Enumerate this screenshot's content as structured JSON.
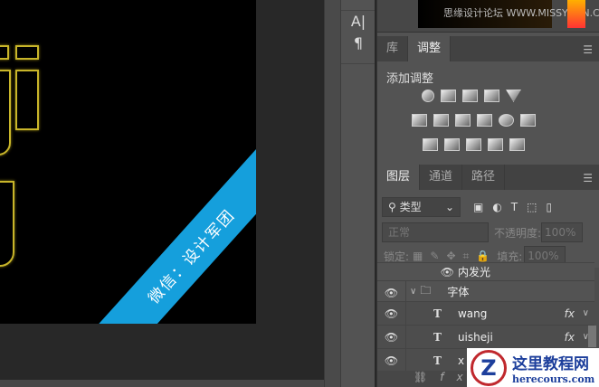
{
  "canvas": {
    "band_text": "微信：设计军团"
  },
  "tools": {
    "char": "A|",
    "para": "¶"
  },
  "thumb": {
    "caption": "思缘设计论坛 WWW.MISSYUAN.COM"
  },
  "adjust_tabs": [
    {
      "label": "库"
    },
    {
      "label": "调整"
    }
  ],
  "adjust": {
    "title": "添加调整",
    "icons_row1": [
      "brightness-icon",
      "levels-icon",
      "curves-icon",
      "exposure-icon",
      "vibrance-icon"
    ],
    "icons_row2": [
      "hue-saturation-icon",
      "color-balance-icon",
      "black-white-icon",
      "photo-filter-icon",
      "channel-mixer-icon",
      "color-lookup-icon"
    ],
    "icons_row3": [
      "invert-icon",
      "posterize-icon",
      "threshold-icon",
      "selective-color-icon",
      "gradient-map-icon"
    ]
  },
  "layer_tabs": [
    {
      "label": "图层"
    },
    {
      "label": "通道"
    },
    {
      "label": "路径"
    }
  ],
  "filter": {
    "label": "类型"
  },
  "blend": {
    "mode": "正常",
    "opacity_label": "不透明度:",
    "opacity": "100%"
  },
  "lock": {
    "label": "锁定:",
    "fill_label": "填充:",
    "fill": "100%"
  },
  "layers": [
    {
      "name": "内发光",
      "type": "effect"
    },
    {
      "name": "字体",
      "type": "group"
    },
    {
      "name": "wang",
      "type": "text",
      "fx": "fx"
    },
    {
      "name": "uisheji",
      "type": "text",
      "fx": "fx"
    },
    {
      "name": "x",
      "type": "text"
    }
  ],
  "watermark": {
    "title": "这里教程网",
    "url": "herecours.com"
  }
}
